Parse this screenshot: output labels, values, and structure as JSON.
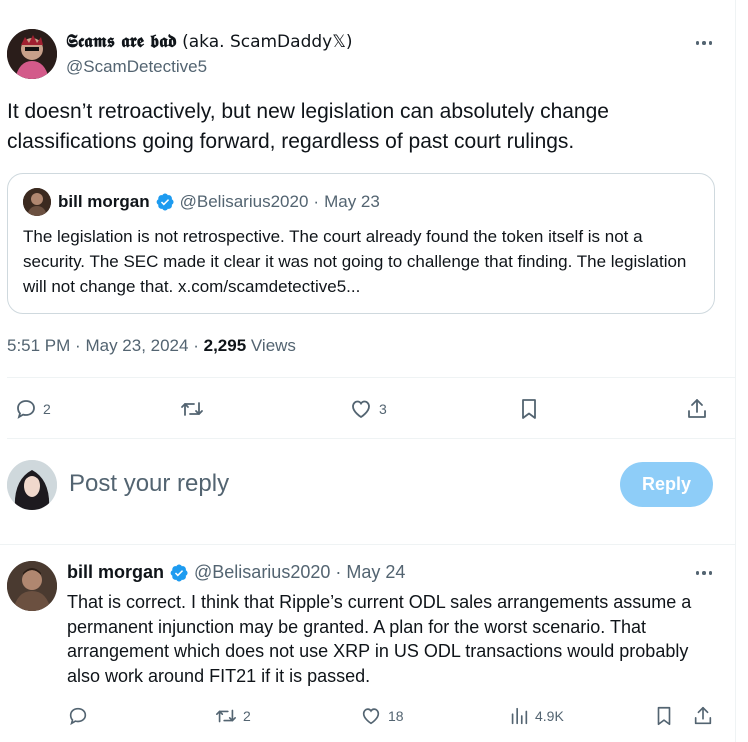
{
  "main_tweet": {
    "display_name_styled": "𝕾𝖈𝖆𝖒𝖘 𝖆𝖗𝖊 𝖇𝖆𝖉",
    "display_name_suffix": " (aka. ScamDaddy𝕏)",
    "handle": "@ScamDetective5",
    "text": "It doesn’t retroactively, but new legislation can absolutely change classifications going forward, regardless of past court rulings.",
    "time": "5:51 PM",
    "date": "May 23, 2024",
    "views_count": "2,295",
    "views_label": "Views",
    "reply_count": "2",
    "like_count": "3"
  },
  "quoted_tweet": {
    "name": "bill morgan",
    "handle": "@Belisarius2020",
    "date": "May 23",
    "text": "The legislation is not retrospective. The court already found the token itself is not a security. The SEC made it clear it was not going to challenge that finding. The legislation will not change that. x.com/scamdetective5..."
  },
  "composer": {
    "placeholder": "Post your reply",
    "button_label": "Reply"
  },
  "reply_tweet": {
    "name": "bill morgan",
    "handle": "@Belisarius2020",
    "date": "May 24",
    "text": "That is correct. I think that Ripple’s current ODL sales arrangements assume a permanent injunction may be granted. A plan for the worst scenario. That arrangement which does not use XRP in US ODL transactions would probably also work around FIT21 if it is passed.",
    "reply_count": "",
    "repost_count": "2",
    "like_count": "18",
    "views_count": "4.9K"
  },
  "separator": "·",
  "colors": {
    "verified": "#1d9bf0",
    "secondary_text": "#536471",
    "reply_button": "#8ecdf8"
  }
}
